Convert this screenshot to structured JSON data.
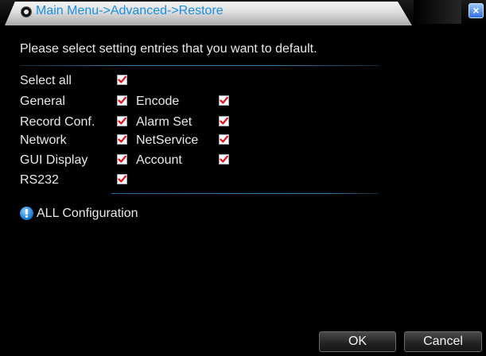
{
  "window": {
    "title": "Main Menu->Advanced->Restore",
    "close_label": "×"
  },
  "instruction": "Please select setting entries that you want to default.",
  "select_all": {
    "label": "Select all",
    "checked": true
  },
  "entries": [
    {
      "label": "General",
      "checked": true
    },
    {
      "label": "Encode",
      "checked": true
    },
    {
      "label": "Record Conf.",
      "checked": true
    },
    {
      "label": "Alarm Set",
      "checked": true
    },
    {
      "label": "Network",
      "checked": true
    },
    {
      "label": "NetService",
      "checked": true
    },
    {
      "label": "GUI Display",
      "checked": true
    },
    {
      "label": "Account",
      "checked": true
    },
    {
      "label": "RS232",
      "checked": true
    }
  ],
  "info": {
    "text": "ALL Configuration",
    "icon": "info-icon"
  },
  "buttons": {
    "ok": "OK",
    "cancel": "Cancel"
  },
  "colors": {
    "title_text": "#1a8fe0",
    "check_mark": "#e0121b",
    "background": "#000000",
    "separator": "#3a7fb0"
  }
}
